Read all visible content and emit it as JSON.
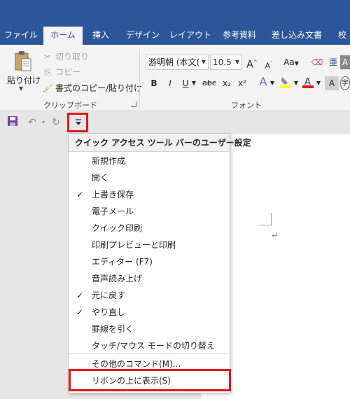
{
  "ribbon_tabs": [
    "ファイル",
    "ホーム",
    "挿入",
    "デザイン",
    "レイアウト",
    "参考資料",
    "差し込み文書",
    "校"
  ],
  "clipboard": {
    "paste_label": "貼り付け",
    "cut_label": "切り取り",
    "copy_label": "コピー",
    "format_painter_label": "書式のコピー/貼り付け",
    "group_label": "クリップボード"
  },
  "font": {
    "font_name": "游明朝 (本文(",
    "font_size": "10.5",
    "group_label": "フォント",
    "buttons": [
      "B",
      "I",
      "U",
      "abc",
      "x₂",
      "x²",
      "A",
      "Aa",
      "A"
    ]
  },
  "quick_access": {
    "items": [
      "save-icon",
      "undo-icon",
      "redo-icon",
      "customize-icon"
    ]
  },
  "menu": {
    "header": "クイック アクセス ツール バーのユーザー設定",
    "items": [
      {
        "label": "新規作成",
        "checked": false
      },
      {
        "label": "開く",
        "checked": false
      },
      {
        "label": "上書き保存",
        "checked": true
      },
      {
        "label": "電子メール",
        "checked": false
      },
      {
        "label": "クイック印刷",
        "checked": false
      },
      {
        "label": "印刷プレビューと印刷",
        "checked": false
      },
      {
        "label": "エディター (F7)",
        "checked": false
      },
      {
        "label": "音声読み上げ",
        "checked": false
      },
      {
        "label": "元に戻す",
        "checked": true
      },
      {
        "label": "やり直し",
        "checked": true
      },
      {
        "label": "罫線を引く",
        "checked": false
      },
      {
        "label": "タッチ/マウス モードの切り替え",
        "checked": false
      }
    ],
    "more_commands": "その他のコマンド(M)...",
    "show_above": "リボンの上に表示(S)"
  },
  "colors": {
    "ribbon_blue": "#2b579a",
    "highlight_red": "#e8141c",
    "font_color_red": "#e81123",
    "highlight_yellow": "#ffff00"
  },
  "doc": {
    "paragraph_mark": "↵"
  }
}
